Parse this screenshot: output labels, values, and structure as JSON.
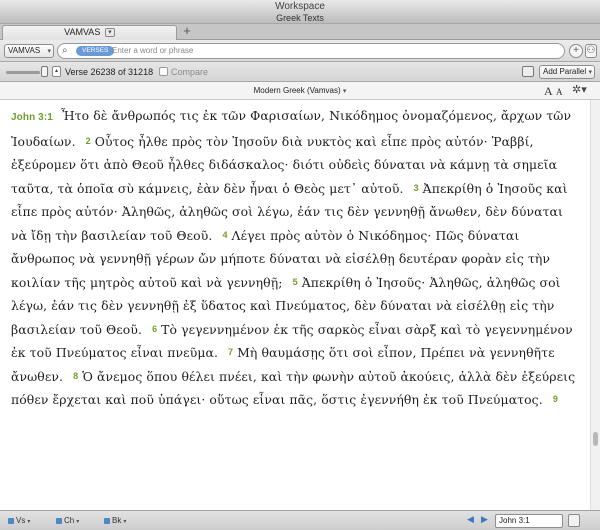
{
  "window": {
    "title": "Workspace"
  },
  "resource_bar": {
    "title": "Greek Texts"
  },
  "tabs": [
    {
      "label": "VAMVAS"
    }
  ],
  "search": {
    "resource_label": "VAMVAS",
    "scope_chip": "VERSES",
    "placeholder": "Enter a word or phrase"
  },
  "nav": {
    "verse_position": "Verse 26238 of 31218",
    "compare_label": "Compare",
    "add_parallel_label": "Add Parallel"
  },
  "text_header": {
    "version_title": "Modern Greek (Vamvas)",
    "font_size_glyph": "A"
  },
  "passage": {
    "reference": "John 3:1",
    "verses": [
      {
        "num": "",
        "text": "Ἦτο δὲ ἄνθρωπός τις ἐκ τῶν Φαρισαίων, Νικόδημος ὀνομαζόμενος, ἄρχων τῶν Ἰουδαίων."
      },
      {
        "num": "2",
        "text": "Οὗτος ἦλθε πρὸς τὸν Ἰησοῦν διὰ νυκτὸς καὶ εἶπε πρὸς αὐτόν· Ῥαββί, ἐξεύρομεν ὅτι ἀπὸ Θεοῦ ἦλθες διδάσκαλος· διότι οὐδεὶς δύναται νὰ κάμνῃ τὰ σημεῖα ταῦτα, τὰ ὁποῖα σὺ κάμνεις, ἐὰν δὲν ἦναι ὁ Θεὸς μετ᾽ αὐτοῦ."
      },
      {
        "num": "3",
        "text": "Ἀπεκρίθη ὁ Ἰησοῦς καὶ εἶπε πρὸς αὐτόν· Ἀληθῶς, ἀληθῶς σοὶ λέγω, ἐάν τις δὲν γεννηθῇ ἄνωθεν, δὲν δύναται νὰ ἴδῃ τὴν βασιλείαν τοῦ Θεοῦ."
      },
      {
        "num": "4",
        "text": "Λέγει πρὸς αὐτὸν ὁ Νικόδημος· Πῶς δύναται ἄνθρωπος νὰ γεννηθῇ γέρων ὤν μήποτε δύναται νὰ εἰσέλθῃ δευτέραν φορὰν εἰς τὴν κοιλίαν τῆς μητρὸς αὐτοῦ καὶ νὰ γεννηθῇ;"
      },
      {
        "num": "5",
        "text": "Ἀπεκρίθη ὁ Ἰησοῦς· Ἀληθῶς, ἀληθῶς σοὶ λέγω, ἐάν τις δὲν γεννηθῇ ἐξ ὕδατος καὶ Πνεύματος, δὲν δύναται νὰ εἰσέλθῃ εἰς τὴν βασιλείαν τοῦ Θεοῦ."
      },
      {
        "num": "6",
        "text": "Τὸ γεγεννημένον ἐκ τῆς σαρκὸς εἶναι σὰρξ καὶ τὸ γεγεννημένον ἐκ τοῦ Πνεύματος εἶναι πνεῦμα."
      },
      {
        "num": "7",
        "text": "Μὴ θαυμάσῃς ὅτι σοὶ εἶπον, Πρέπει νὰ γεννηθῆτε ἄνωθεν."
      },
      {
        "num": "8",
        "text": "Ὁ ἄνεμος ὅπου θέλει πνέει, καὶ τὴν φωνὴν αὐτοῦ ἀκούεις, ἀλλὰ δὲν ἐξεύρεις πόθεν ἔρχεται καὶ ποῦ ὑπάγει· οὕτως εἶναι πᾶς, ὅστις ἐγεννήθη ἐκ τοῦ Πνεύματος."
      },
      {
        "num": "9",
        "text": ""
      }
    ]
  },
  "bottom": {
    "links": [
      {
        "label": "Vs"
      },
      {
        "label": "Ch"
      },
      {
        "label": "Bk"
      }
    ],
    "reference_value": "John 3:1"
  },
  "colors": {
    "verse_number": "#6f9f2a",
    "scope_chip": "#6a9ad6",
    "link_blue": "#4a86c8"
  },
  "icons": [
    "search-icon",
    "add-icon",
    "share-icon",
    "panel-icon",
    "gear-icon",
    "previous-arrow-icon",
    "next-arrow-icon",
    "resize-icon"
  ]
}
